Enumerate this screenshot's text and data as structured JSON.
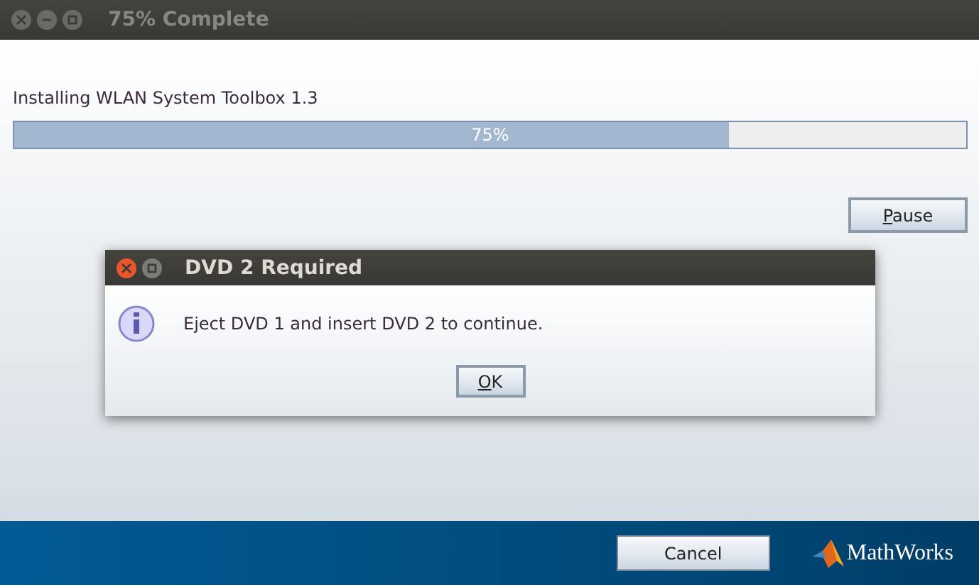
{
  "window": {
    "title": "75% Complete"
  },
  "install": {
    "label": "Installing WLAN System Toolbox 1.3",
    "level": 0.75,
    "reading": "75%"
  },
  "pause_button": "Pause",
  "dialog": {
    "title": "DVD 2 Required",
    "message": "Eject DVD 1 and insert DVD 2 to continue.",
    "button": "OK"
  },
  "footer": {
    "cancel_button": "Cancel",
    "brand": "MathWorks"
  }
}
